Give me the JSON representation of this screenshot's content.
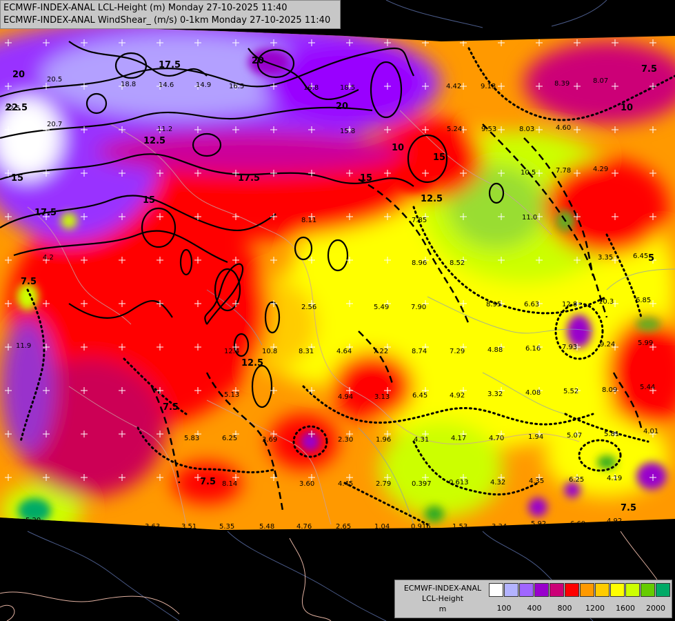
{
  "header": {
    "line1": "ECMWF-INDEX-ANAL LCL-Height (m) Monday 27-10-2025 11:40",
    "line2": "ECMWF-INDEX-ANAL WindShear_ (m/s) 0-1km Monday 27-10-2025 11:40"
  },
  "legend": {
    "title1": "ECMWF-INDEX-ANAL",
    "title2": "LCL-Height",
    "unit": "m",
    "colors": [
      "#ffffff",
      "#b3b3ff",
      "#a066ff",
      "#9900cc",
      "#cc0077",
      "#ff0000",
      "#ff9900",
      "#ffcc00",
      "#ffff00",
      "#ccff00",
      "#66cc00",
      "#00aa66",
      "#00aaff"
    ],
    "ticks": [
      "100",
      "400",
      "800",
      "1200",
      "1600",
      "2000"
    ]
  },
  "map": {
    "contour_labels": [
      "20",
      "17.5",
      "15",
      "12.5",
      "10",
      "7.5",
      "5",
      "22.5"
    ],
    "values": [
      "20.5",
      "18.8",
      "14.6",
      "14.9",
      "16.5",
      "16.8",
      "18.5",
      "20.7",
      "11.2",
      "15.8",
      "22.5",
      "4.42",
      "9.13",
      "8.39",
      "8.07",
      "5.24",
      "9.53",
      "8.03",
      "4.60",
      "10.5",
      "7.78",
      "4.29",
      "8.11",
      "7.85",
      "8.96",
      "11.0",
      "8.52",
      "3.35",
      "6.45",
      "4.2",
      "2.56",
      "5.49",
      "7.90",
      "8.95",
      "6.63",
      "12.8",
      "10.3",
      "6.85",
      "11.9",
      "12.4",
      "10.8",
      "8.31",
      "4.64",
      "7.22",
      "8.74",
      "7.29",
      "4.88",
      "6.16",
      "7.93",
      "9.24",
      "5.99",
      "5.13",
      "4.94",
      "3.13",
      "6.45",
      "4.92",
      "3.32",
      "4.08",
      "5.52",
      "8.09",
      "5.44",
      "5.83",
      "6.25",
      "3.69",
      "2.30",
      "1.96",
      "4.31",
      "4.17",
      "4.70",
      "1.94",
      "5.07",
      "5.81",
      "4.01",
      "8.14",
      "3.60",
      "4.45",
      "2.79",
      "0.397",
      "0.613",
      "4.32",
      "4.35",
      "6.25",
      "4.19",
      "5.20",
      "3.63",
      "3.51",
      "5.35",
      "5.48",
      "4.76",
      "2.65",
      "1.04",
      "0.916",
      "1.53",
      "3.34",
      "5.92",
      "6.69",
      "4.92"
    ]
  }
}
